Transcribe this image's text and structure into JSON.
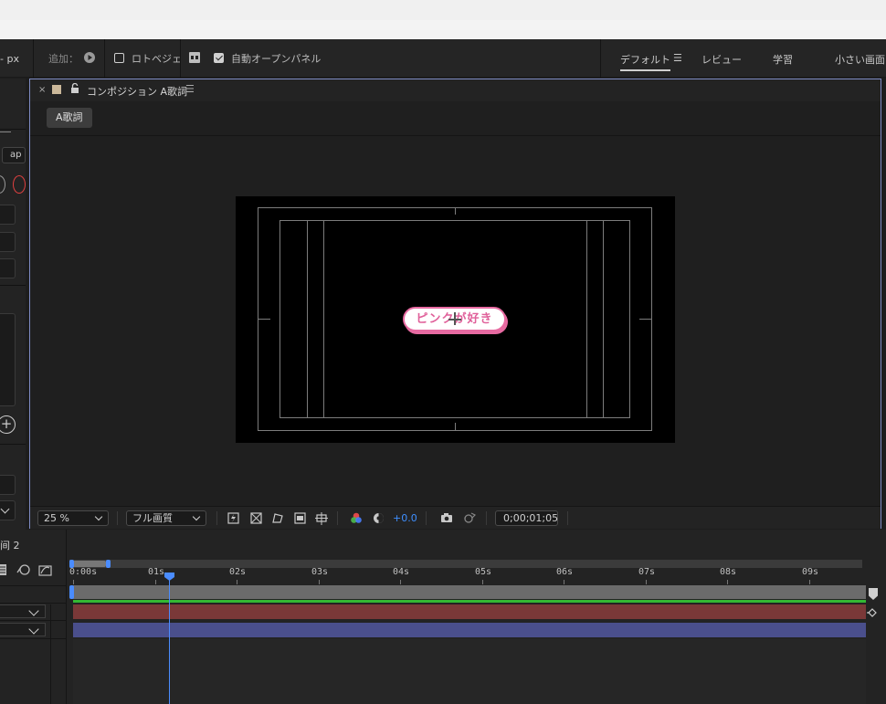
{
  "toolbar": {
    "unit_fragment": "- px",
    "add_label": "追加：",
    "rotobezier_label": "ロトベジェ",
    "rotobezier_checked": false,
    "auto_open_label": "自動オープンパネル",
    "auto_open_checked": true
  },
  "workspaces": [
    {
      "label": "デフォルト",
      "active": true
    },
    {
      "label": "レビュー",
      "active": false
    },
    {
      "label": "学習",
      "active": false
    },
    {
      "label": "小さい画面",
      "active": false
    }
  ],
  "left_panel": {
    "field_fragment": "ap"
  },
  "composition": {
    "panel_title": "コンポジション A歌詞",
    "tab_label": "A歌詞",
    "overlay_text": "ピンクが好き",
    "zoom": "25 %",
    "quality": "フル画質",
    "exposure": "+0.0",
    "timecode": "0;00;01;05"
  },
  "timeline": {
    "header_fragment": "间 2",
    "ruler_labels": [
      "0:00s",
      "01s",
      "02s",
      "03s",
      "04s",
      "05s",
      "06s",
      "07s",
      "08s",
      "09s"
    ],
    "layers": [
      {
        "color": "#7a3838"
      },
      {
        "color": "#4a4f8c"
      }
    ]
  }
}
